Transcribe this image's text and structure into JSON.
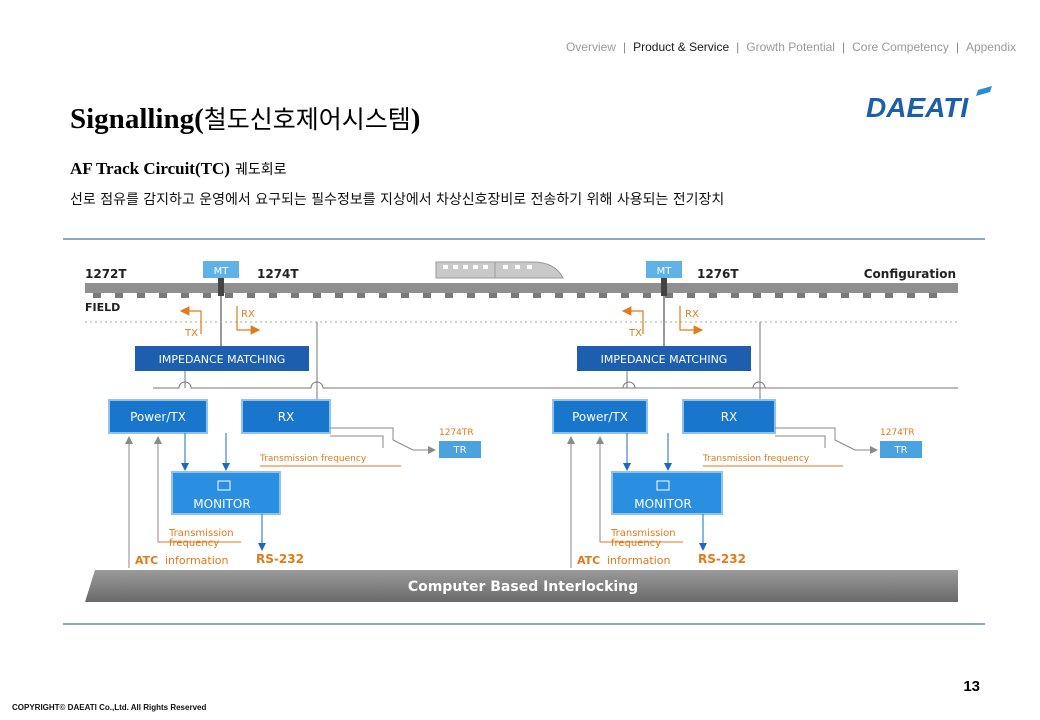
{
  "nav": {
    "items": [
      "Overview",
      "Product & Service",
      "Growth Potential",
      "Core Competency",
      "Appendix"
    ],
    "separator": "|"
  },
  "title": {
    "main": "Signalling(",
    "korean": "철도신호제어시스템",
    "close": ")"
  },
  "logo": {
    "text": "DAEATI",
    "color": "#1b5fa8",
    "accent": "#2b8ad6"
  },
  "subtitle": {
    "en": "AF Track Circuit(TC)",
    "kr": "궤도회로"
  },
  "description": "선로 점유를 감지하고 운영에서 요구되는 필수정보를 지상에서 차상신호장비로 전송하기 위해 사용되는 전기장치",
  "diagram": {
    "track_labels": [
      "1272T",
      "1274T",
      "1276T"
    ],
    "configuration": "Configuration",
    "field": "FIELD",
    "mt": "MT",
    "tx": "TX",
    "rx_arrow": "RX",
    "impedance": "IMPEDANCE MATCHING",
    "power_tx": "Power/TX",
    "rx": "RX",
    "monitor": "MONITOR",
    "tr_label": "1274TR",
    "tr": "TR",
    "transmission_frequency": "Transmission frequency",
    "transmission": "Transmission",
    "frequency": "frequency",
    "atc": "ATC",
    "information": "information",
    "rs232": "RS-232",
    "cbi": "Computer Based Interlocking"
  },
  "colors": {
    "box_blue": "#1877cc",
    "impedance_blue": "#1d5fae",
    "orange": "#e07a1b",
    "tr_blue": "#4aa3de",
    "rule": "#8aa9c8"
  },
  "page_number": "13",
  "copyright": "COPYRIGHT© DAEATI Co.,Ltd. All Rights Reserved"
}
